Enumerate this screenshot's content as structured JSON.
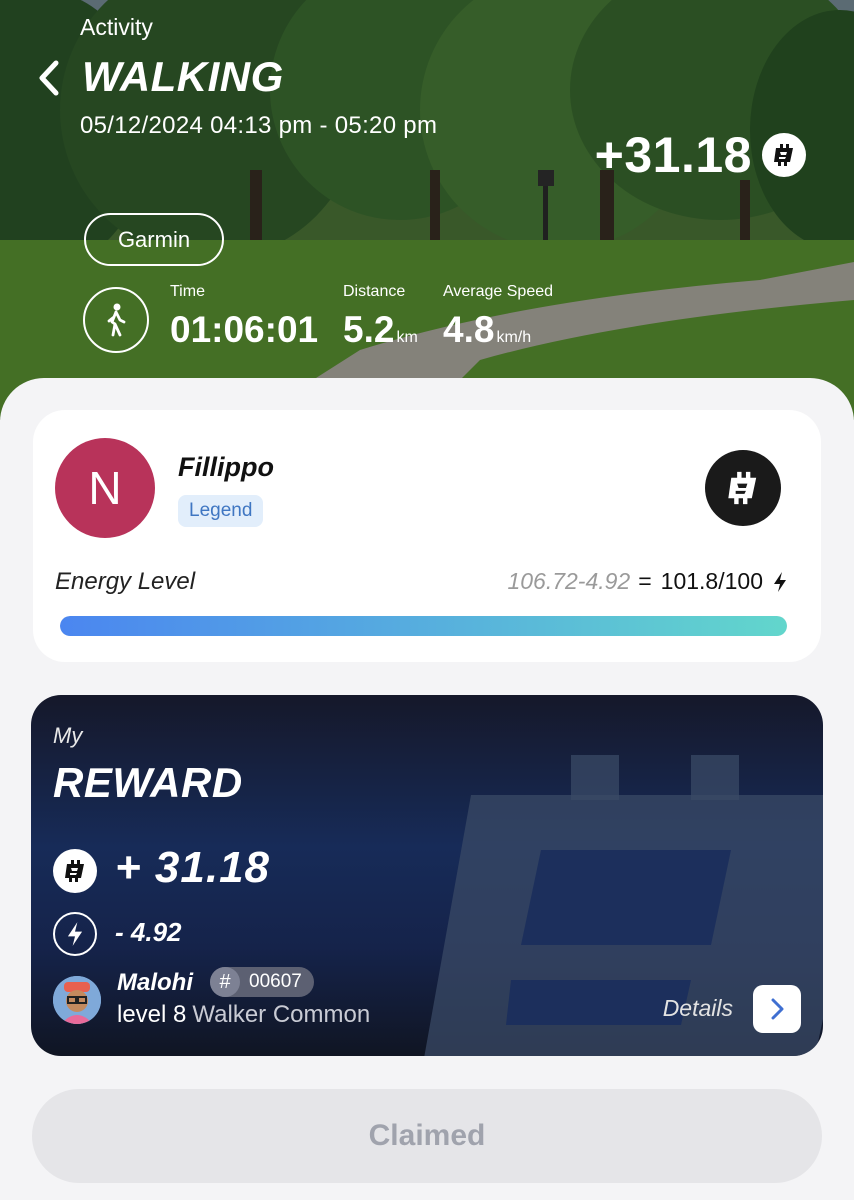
{
  "header": {
    "section_label": "Activity",
    "activity_name": "WALKING",
    "datetime_range": "05/12/2024 04:13 pm - 05:20 pm",
    "earned_amount": "+31.18",
    "device": "Garmin"
  },
  "stats": {
    "time": {
      "label": "Time",
      "value": "01:06:01"
    },
    "distance": {
      "label": "Distance",
      "value": "5.2",
      "unit": "km"
    },
    "speed": {
      "label": "Average Speed",
      "value": "4.8",
      "unit": "km/h"
    }
  },
  "profile": {
    "avatar_letter": "N",
    "avatar_color": "#b8335a",
    "name": "Fillippo",
    "rank": "Legend",
    "energy_label": "Energy Level",
    "energy_calc": "106.72-4.92",
    "energy_equals": "=",
    "energy_value": "101.8/100",
    "energy_fill_fraction": 1.0
  },
  "reward": {
    "prefix": "My",
    "title": "REWARD",
    "amount": "+ 31.18",
    "energy_used": "- 4.92",
    "nft_name": "Malohi",
    "nft_hash": "#",
    "nft_id": "00607",
    "level": "level 8",
    "tier": "Walker Common",
    "details_label": "Details"
  },
  "claim_button": {
    "label": "Claimed"
  },
  "colors": {
    "accent_blue": "#4b86f0",
    "accent_teal": "#62d6cc",
    "rank_badge_bg": "#e2eefb",
    "rank_badge_text": "#3f76c2",
    "reward_card_bg": "#172b58"
  },
  "icons": [
    "back-chevron-icon",
    "coin-icon",
    "walker-icon",
    "bolt-icon",
    "chevron-right-icon"
  ]
}
